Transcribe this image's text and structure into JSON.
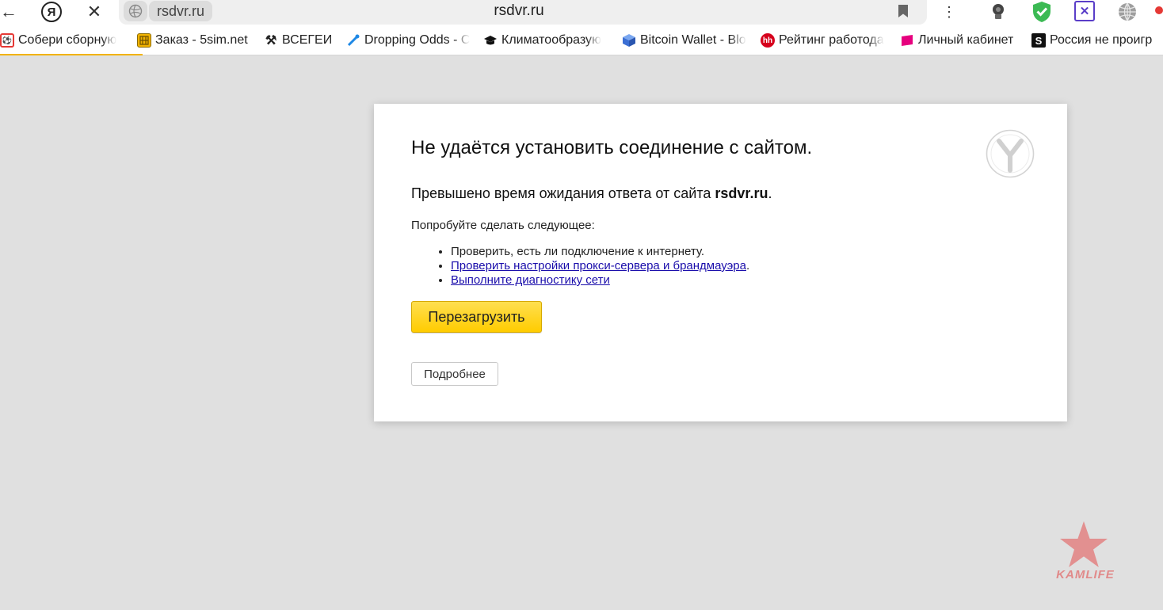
{
  "browser": {
    "url_chip": "rsdvr.ru",
    "url_center": "rsdvr.ru",
    "yandex_button": "Я",
    "extension_x": "✕"
  },
  "bookmarks": [
    {
      "label": "Собери сборную",
      "icon": "ball-icon",
      "color": "#e53935"
    },
    {
      "label": "Заказ - 5sim.net",
      "icon": "sim-card-icon",
      "color": "#f2b300"
    },
    {
      "label": "ВСЕГЕИ",
      "icon": "hammers-icon",
      "color": "#222222"
    },
    {
      "label": "Dropping Odds - C",
      "icon": "dropping-odds-icon",
      "color": "#1e88e5"
    },
    {
      "label": "Климатообразую",
      "icon": "graduation-cap-icon",
      "color": "#111111"
    },
    {
      "label": "Bitcoin Wallet - Blo",
      "icon": "bitcoin-wallet-icon",
      "color": "#3b6fd4"
    },
    {
      "label": "Рейтинг работода",
      "icon": "hh-icon",
      "fav_text": "hh",
      "color": "#d6001c"
    },
    {
      "label": "Личный кабинет",
      "icon": "lk-icon",
      "color": "#e6007e"
    },
    {
      "label": "Россия не проигр",
      "icon": "s-icon",
      "fav_text": "S",
      "color": "#111111"
    }
  ],
  "error": {
    "title": "Не удаётся установить соединение с сайтом.",
    "subtitle_prefix": "Превышено время ожидания ответа от сайта ",
    "subtitle_host": "rsdvr.ru",
    "subtitle_suffix": ".",
    "try_label": "Попробуйте сделать следующее:",
    "step_1": "Проверить, есть ли подключение к интернету.",
    "step_2_link": "Проверить настройки прокси-сервера и брандмауэра",
    "step_2_suffix": ".",
    "step_3_link": "Выполните диагностику сети",
    "reload_label": "Перезагрузить",
    "details_label": "Подробнее"
  },
  "watermark": {
    "text": "KAMLIFE"
  },
  "colors": {
    "page_bg": "#e0e0e0",
    "reload_bg": "#ffcc00",
    "link": "#1a0dab",
    "loading_line": "#f2b300"
  }
}
